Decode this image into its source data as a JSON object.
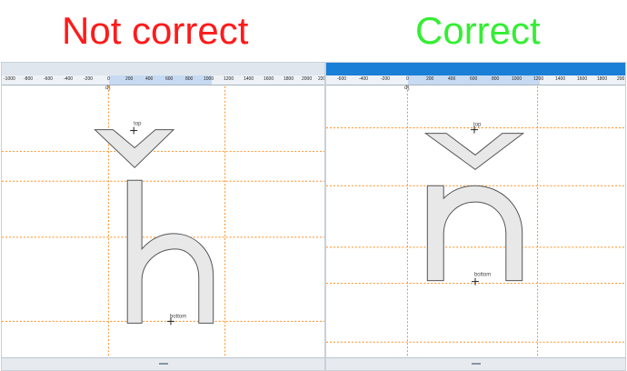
{
  "headings": {
    "left": "Not correct",
    "right": "Correct"
  },
  "colors": {
    "wrong": "#ff1a1a",
    "right": "#33ee33",
    "guide": "#ff8c1a",
    "glyph_fill": "#e8e8e8",
    "titlebar_active": "#1a7fd6"
  },
  "left_panel": {
    "ruler_ticks": [
      "-1000",
      "-800",
      "-600",
      "-400",
      "-200",
      "0",
      "200",
      "400",
      "600",
      "800",
      "1000",
      "1200",
      "1400",
      "1600",
      "1800",
      "2000",
      "220"
    ],
    "origin_marker": "ʤ",
    "anchors": {
      "top": "top",
      "bottom": "bottom"
    }
  },
  "right_panel": {
    "ruler_ticks": [
      "-600",
      "-400",
      "-200",
      "0",
      "200",
      "400",
      "600",
      "800",
      "1000",
      "1200",
      "1400",
      "1600",
      "1800",
      "200"
    ],
    "origin_marker": "ʤ",
    "anchors": {
      "top": "top",
      "bottom": "bottom"
    }
  }
}
